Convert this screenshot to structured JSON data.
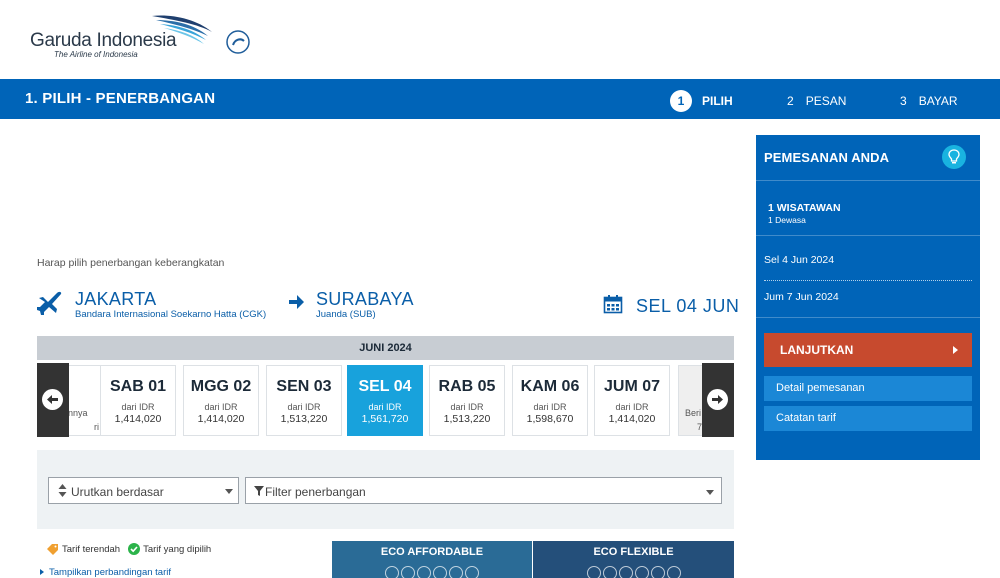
{
  "brand": {
    "name": "Garuda Indonesia",
    "tagline": "The Airline of Indonesia"
  },
  "topbar": {
    "title": "1. PILIH - PENERBANGAN",
    "steps": [
      {
        "num": "1",
        "label": "PILIH",
        "active": true
      },
      {
        "num": "2",
        "label": "PESAN",
        "active": false
      },
      {
        "num": "3",
        "label": "BAYAR",
        "active": false
      }
    ]
  },
  "prompt": "Harap pilih penerbangan keberangkatan",
  "route": {
    "origin_city": "JAKARTA",
    "origin_airport": "Bandara Internasional Soekarno Hatta (CGK)",
    "destination_city": "SURABAYA",
    "destination_airport": "Juanda (SUB)",
    "date": "SEL 04 JUN"
  },
  "month": "JUNI 2024",
  "dates": [
    {
      "day": "SAB 01",
      "from": "dari IDR",
      "price": "1,414,020",
      "selected": false
    },
    {
      "day": "MGG 02",
      "from": "dari IDR",
      "price": "1,414,020",
      "selected": false
    },
    {
      "day": "SEN 03",
      "from": "dari IDR",
      "price": "1,513,220",
      "selected": false
    },
    {
      "day": "SEL 04",
      "from": "dari IDR",
      "price": "1,561,720",
      "selected": true
    },
    {
      "day": "RAB 05",
      "from": "dari IDR",
      "price": "1,513,220",
      "selected": false
    },
    {
      "day": "KAM 06",
      "from": "dari IDR",
      "price": "1,598,670",
      "selected": false
    },
    {
      "day": "JUM 07",
      "from": "dari IDR",
      "price": "1,414,020",
      "selected": false
    }
  ],
  "partial_left": {
    "line1": "nnya",
    "line2": "ri"
  },
  "partial_right": {
    "line1": "Beri",
    "line2": "7"
  },
  "filters": {
    "sort_label": "Urutkan berdasar",
    "filter_label": "Filter penerbangan"
  },
  "legend": {
    "lowest": "Tarif terendah",
    "selected": "Tarif yang dipilih",
    "compare": "Tampilkan perbandingan tarif"
  },
  "fares": [
    {
      "label": "ECO AFFORDABLE",
      "color": "#2a6b96"
    },
    {
      "label": "ECO FLEXIBLE",
      "color": "#244f7a"
    }
  ],
  "panel": {
    "title": "PEMESANAN ANDA",
    "travellers": "1 WISATAWAN",
    "travellers_sub": "1 Dewasa",
    "depart_date": "Sel 4 Jun 2024",
    "return_date": "Jum 7 Jun 2024",
    "continue_label": "LANJUTKAN",
    "booking_detail": "Detail pemesanan",
    "fare_notes": "Catatan tarif"
  },
  "colors": {
    "brand_blue": "#0064b8",
    "selected_date": "#18a2dc",
    "continue": "#c74a2e"
  }
}
